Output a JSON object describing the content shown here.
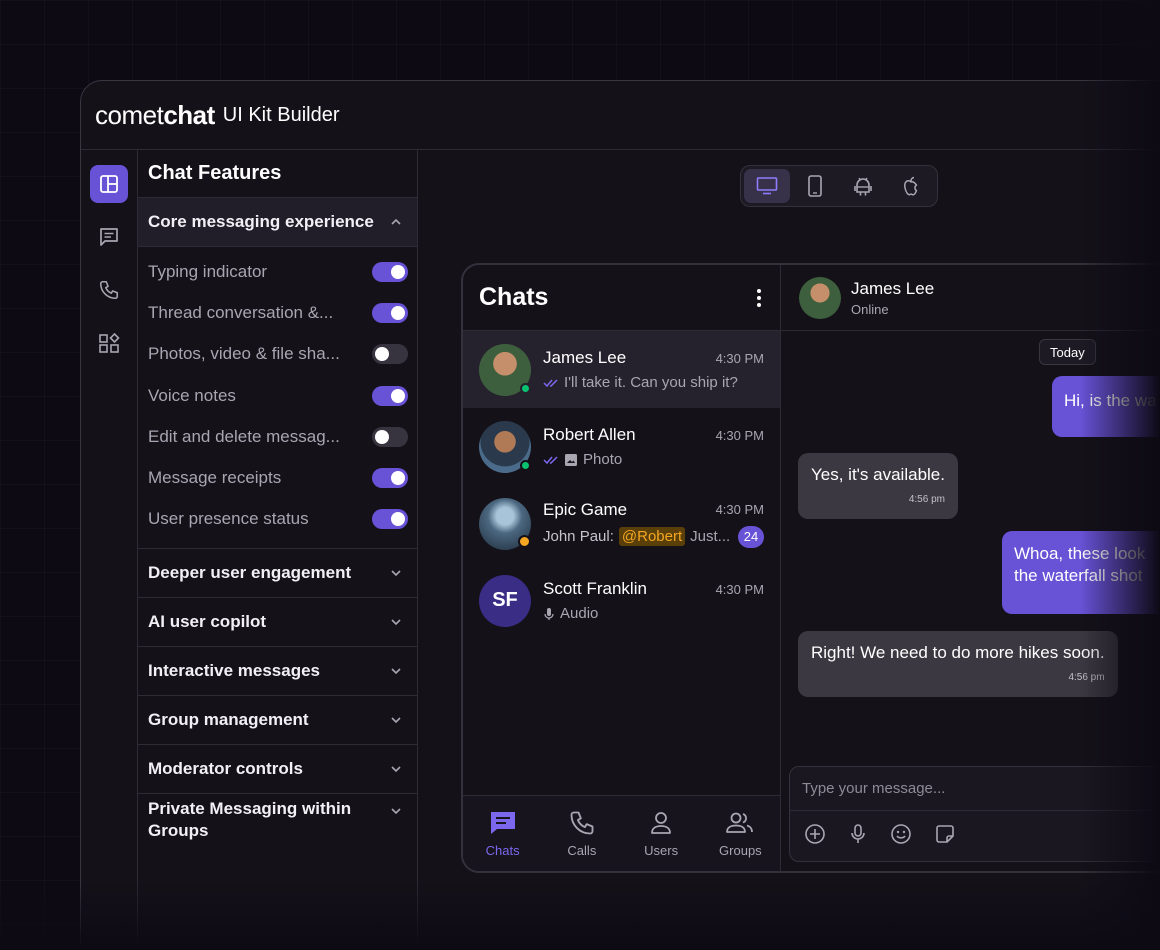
{
  "brand": {
    "comet": "comet",
    "chat": "chat",
    "subtitle": "UI Kit Builder"
  },
  "rail": {
    "items": [
      {
        "icon": "layout-icon",
        "active": true
      },
      {
        "icon": "message-icon",
        "active": false
      },
      {
        "icon": "phone-icon",
        "active": false
      },
      {
        "icon": "widgets-icon",
        "active": false
      }
    ]
  },
  "features": {
    "title": "Chat Features",
    "core_section": {
      "title": "Core messaging experience",
      "items": [
        {
          "label": "Typing indicator",
          "on": true
        },
        {
          "label": "Thread conversation &...",
          "on": true
        },
        {
          "label": "Photos, video & file sha...",
          "on": false
        },
        {
          "label": "Voice notes",
          "on": true
        },
        {
          "label": "Edit and delete messag...",
          "on": false
        },
        {
          "label": "Message receipts",
          "on": true
        },
        {
          "label": "User presence status",
          "on": true
        }
      ]
    },
    "sections": [
      "Deeper user engagement",
      "AI user copilot",
      "Interactive messages",
      "Group management",
      "Moderator controls",
      "Private Messaging within Groups"
    ]
  },
  "device_switch": [
    "desktop-icon",
    "mobile-icon",
    "android-icon",
    "apple-icon"
  ],
  "chats": {
    "title": "Chats",
    "conversations": [
      {
        "name": "James Lee",
        "time": "4:30 PM",
        "preview": "I'll take it. Can you ship it?",
        "receipt": "read"
      },
      {
        "name": "Robert Allen",
        "time": "4:30 PM",
        "preview": "Photo",
        "receipt": "read"
      },
      {
        "name": "Epic Game",
        "time": "4:30 PM",
        "sender": "John Paul:",
        "mention": "@Robert",
        "preview": "Just...",
        "unread": "24"
      },
      {
        "name": "Scott Franklin",
        "time": "4:30 PM",
        "preview": "Audio",
        "initials": "SF"
      }
    ],
    "tabs": [
      {
        "label": "Chats",
        "icon": "chat-bubble-icon",
        "active": true
      },
      {
        "label": "Calls",
        "icon": "phone-icon",
        "active": false
      },
      {
        "label": "Users",
        "icon": "user-icon",
        "active": false
      },
      {
        "label": "Groups",
        "icon": "group-icon",
        "active": false
      }
    ]
  },
  "conversation": {
    "name": "James Lee",
    "status": "Online",
    "day_label": "Today",
    "messages": [
      {
        "dir": "out",
        "text": "Hi, is the wa"
      },
      {
        "dir": "in",
        "text": "Yes, it's available.",
        "time": "4:56 pm"
      },
      {
        "dir": "out",
        "text": "Whoa, these look",
        "text2": "the waterfall shot"
      },
      {
        "dir": "in",
        "text": "Right! We need to do more hikes soon.",
        "time": "4:56 pm"
      }
    ],
    "composer_placeholder": "Type your message..."
  },
  "colors": {
    "accent": "#6852d6",
    "online": "#09c26f",
    "mention": "#f5a623"
  }
}
